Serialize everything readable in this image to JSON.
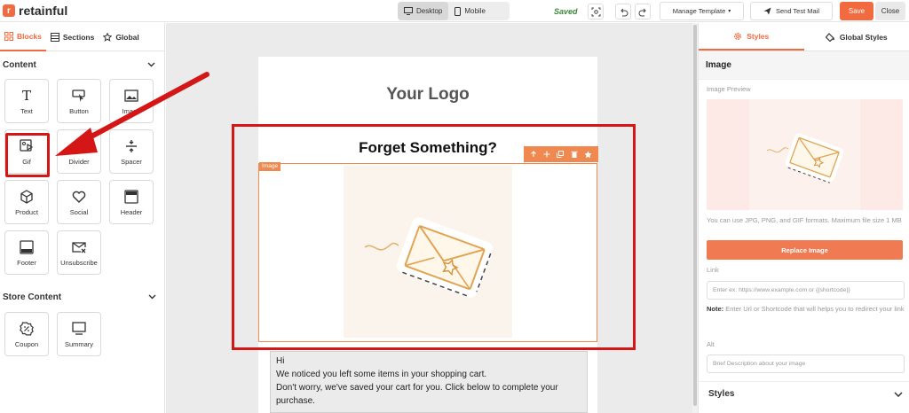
{
  "app": {
    "logo_text": "retainful",
    "logo_letter": "r"
  },
  "topbar": {
    "device_desktop": "Desktop",
    "device_mobile": "Mobile",
    "saved": "Saved",
    "manage_template": "Manage Template",
    "send_test_mail": "Send Test Mail",
    "save": "Save",
    "close": "Close"
  },
  "left": {
    "tabs": [
      "Blocks",
      "Sections",
      "Global"
    ],
    "content_heading": "Content",
    "blocks": [
      "Text",
      "Button",
      "Image",
      "Gif",
      "Divider",
      "Spacer",
      "Product",
      "Social",
      "Header",
      "Footer",
      "Unsubscribe"
    ],
    "store_heading": "Store Content",
    "store_blocks": [
      "Coupon",
      "Summary"
    ]
  },
  "email": {
    "logo": "Your Logo",
    "heading": "Forget Something?",
    "image_tag": "Image",
    "body_lines": [
      "Hi",
      "We noticed you left some items in your shopping cart.",
      "Don't worry, we've saved your cart for you. Click below to complete your",
      "purchase."
    ]
  },
  "right": {
    "tabs": [
      "Styles",
      "Global Styles"
    ],
    "section_title": "Image",
    "image_preview_label": "Image Preview",
    "hint": "You can use JPG, PNG, and GIF formats. Maximum file size 1 MB",
    "replace_button": "Replace Image",
    "link_label": "Link",
    "link_placeholder": "Enter ex: https://www.example.com or {{shortcode}}",
    "note_label": "Note:",
    "note_text": " Enter Url or Shortcode that will helps you to redirect your link",
    "alt_label": "Alt",
    "alt_placeholder": "Brief Description about your image",
    "styles_label": "Styles"
  },
  "colors": {
    "accent": "#f26a3f",
    "annotation": "#d41616"
  }
}
